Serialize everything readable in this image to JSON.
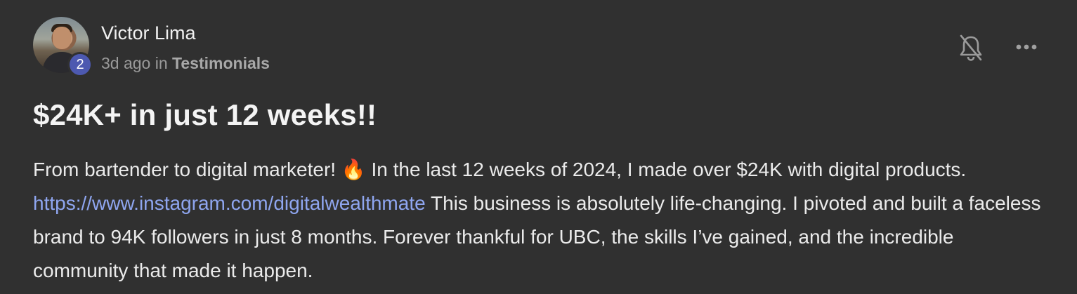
{
  "author": {
    "name": "Victor Lima",
    "level": "2",
    "avatar_icon": "user-avatar-photo"
  },
  "meta": {
    "time_ago": "3d ago",
    "in_word": "in",
    "category": "Testimonials"
  },
  "actions": {
    "bell_icon": "bell-off-icon",
    "more_icon": "ellipsis-icon"
  },
  "post": {
    "title": "$24K+ in just 12 weeks!!",
    "body_part1": "From bartender to digital marketer! ",
    "emoji": "🔥",
    "body_part2": " In the last 12 weeks of 2024, I made over $24K with digital products. ",
    "link": "https://www.instagram.com/digitalwealthmate",
    "body_part3": " This business is absolutely life-changing. I pivoted and built a faceless brand to 94K followers in just 8 months. Forever thankful for UBC, the skills I’ve gained, and the incredible community that made it happen."
  },
  "colors": {
    "background": "#303030",
    "link": "#8fa6f0",
    "level_badge": "#4d59b0"
  }
}
